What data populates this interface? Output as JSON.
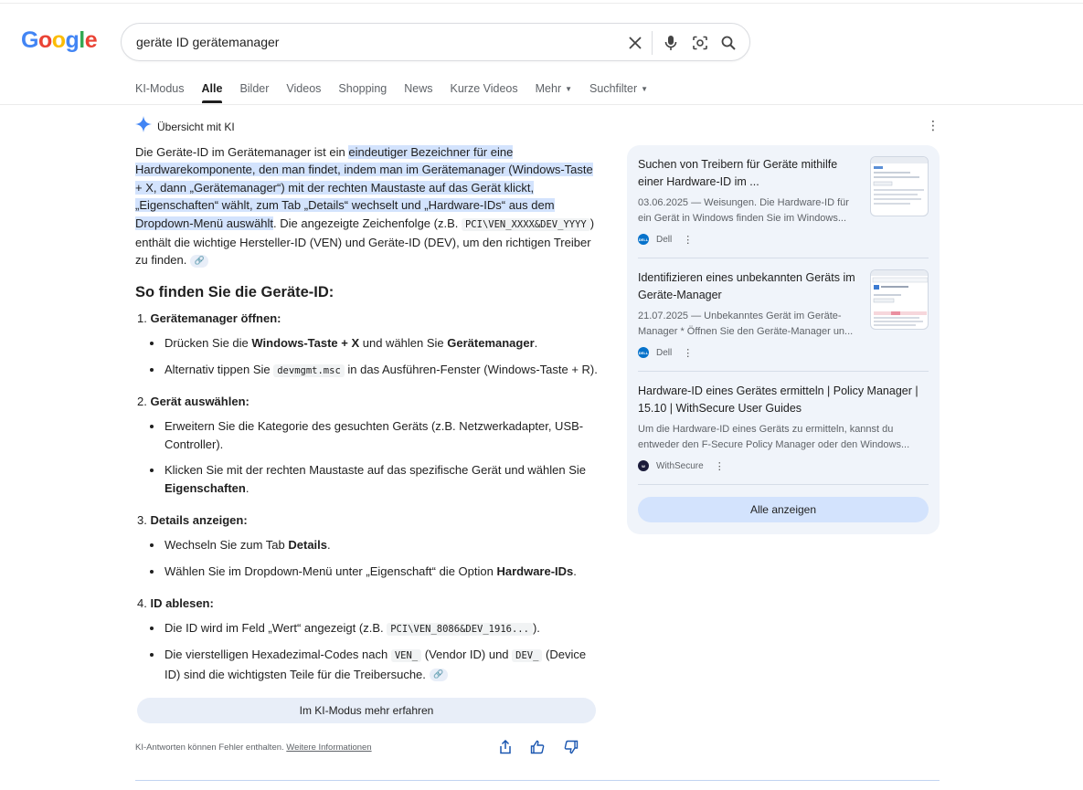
{
  "logo": {
    "text": "Google"
  },
  "search": {
    "query": "geräte ID gerätemanager"
  },
  "tabs": [
    {
      "label": "KI-Modus"
    },
    {
      "label": "Alle"
    },
    {
      "label": "Bilder"
    },
    {
      "label": "Videos"
    },
    {
      "label": "Shopping"
    },
    {
      "label": "News"
    },
    {
      "label": "Kurze Videos"
    },
    {
      "label": "Mehr"
    },
    {
      "label": "Suchfilter"
    }
  ],
  "ai_overview": {
    "header": "Übersicht mit KI",
    "intro_plain_1": "Die Geräte-ID im Gerätemanager ist ein ",
    "intro_highlight": "eindeutiger Bezeichner für eine Hardwarekomponente, den man findet, indem man im Gerätemanager (Windows-Taste + X, dann „Gerätemanager“) mit der rechten Maustaste auf das Gerät klickt, „Eigenschaften“ wählt, zum Tab „Details“ wechselt und „Hardware-IDs“ aus dem Dropdown-Menü auswählt",
    "intro_plain_2": ". Die angezeigte Zeichenfolge (z.B. ",
    "intro_code": "PCI\\VEN_XXXX&DEV_YYYY",
    "intro_plain_3": ") enthält die wichtige Hersteller-ID (VEN) und Geräte-ID (DEV), um den richtigen Treiber zu finden.",
    "heading": "So finden Sie die Geräte-ID:",
    "steps": [
      {
        "num": "1.",
        "title": "Gerätemanager öffnen:"
      },
      {
        "num": "2.",
        "title": "Gerät auswählen:"
      },
      {
        "num": "3.",
        "title": "Details anzeigen:"
      },
      {
        "num": "4.",
        "title": "ID ablesen:"
      }
    ],
    "bullets": {
      "s1b1_a": "Drücken Sie die ",
      "s1b1_b": "Windows-Taste + X",
      "s1b1_c": " und wählen Sie ",
      "s1b1_d": "Gerätemanager",
      "s1b1_e": ".",
      "s1b2_a": "Alternativ tippen Sie ",
      "s1b2_code": "devmgmt.msc",
      "s1b2_b": " in das Ausführen-Fenster (Windows-Taste + R).",
      "s2b1": "Erweitern Sie die Kategorie des gesuchten Geräts (z.B. Netzwerkadapter, USB-Controller).",
      "s2b2_a": "Klicken Sie mit der rechten Maustaste auf das spezifische Gerät und wählen Sie ",
      "s2b2_b": "Eigenschaften",
      "s2b2_c": ".",
      "s3b1_a": "Wechseln Sie zum Tab ",
      "s3b1_b": "Details",
      "s3b1_c": ".",
      "s3b2_a": "Wählen Sie im Dropdown-Menü unter „Eigenschaft“ die Option ",
      "s3b2_b": "Hardware-IDs",
      "s3b2_c": ".",
      "s4b1_a": "Die ID wird im Feld „Wert“ angezeigt (z.B. ",
      "s4b1_code": "PCI\\VEN_8086&DEV_1916...",
      "s4b1_b": ").",
      "s4b2_a": "Die vierstelligen Hexadezimal-Codes nach ",
      "s4b2_code1": "VEN_",
      "s4b2_b": " (Vendor ID) und ",
      "s4b2_code2": "DEV_",
      "s4b2_c": " (Device ID) sind die wichtigsten Teile für die Treibersuche."
    },
    "mode_button": "Im KI-Modus mehr erfahren",
    "footer_note": "KI-Antworten können Fehler enthalten. ",
    "footer_link": "Weitere Informationen"
  },
  "sources": [
    {
      "title": "Suchen von Treibern für Geräte mithilfe einer Hardware-ID im ...",
      "snippet": "03.06.2025 — Weisungen. Die Hardware-ID für ein Gerät in Windows finden Sie im Windows...",
      "site": "Dell",
      "favicon_color": "#0672cb"
    },
    {
      "title": "Identifizieren eines unbekannten Geräts im Geräte-Manager",
      "snippet": "21.07.2025 — Unbekanntes Gerät im Geräte-Manager * Öffnen Sie den Geräte-Manager un...",
      "site": "Dell",
      "favicon_color": "#0672cb"
    },
    {
      "title": "Hardware-ID eines Gerätes ermitteln | Policy Manager | 15.10 | WithSecure User Guides",
      "snippet": "Um die Hardware-ID eines Geräts zu ermitteln, kannst du entweder den F-Secure Policy Manager oder den Windows...",
      "site": "WithSecure",
      "favicon_color": "#1a1a3a"
    }
  ],
  "show_all_button": "Alle anzeigen",
  "colors": {
    "highlight": "#d3e3fd",
    "panel_bg": "#f0f4fa",
    "accent_blue": "#4285f4"
  }
}
